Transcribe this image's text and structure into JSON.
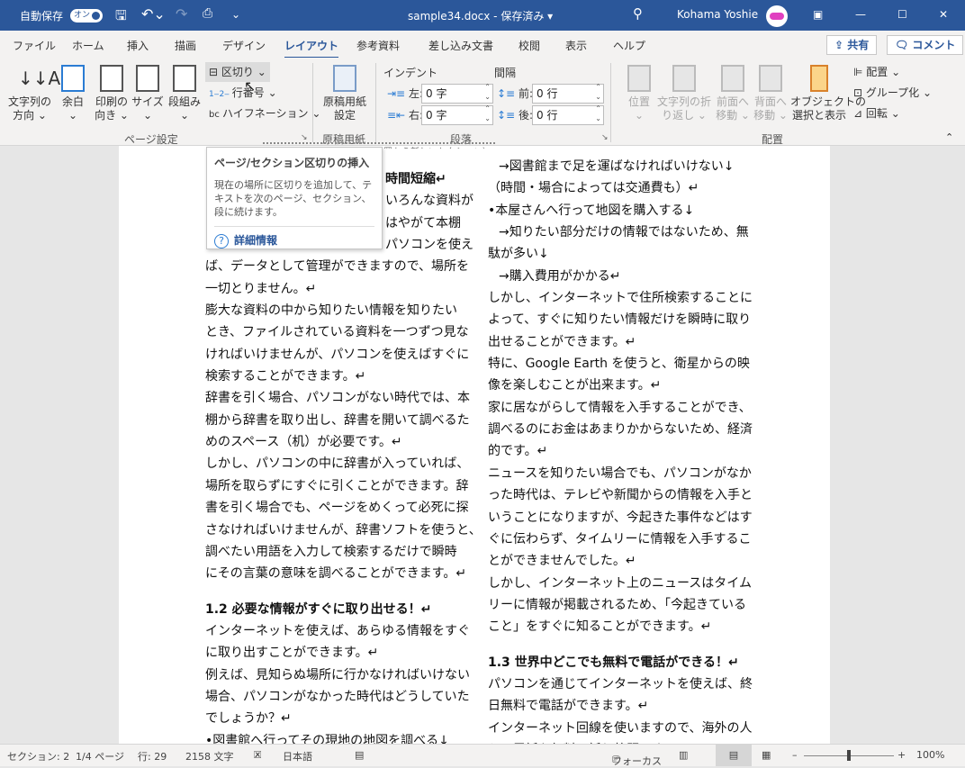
{
  "titlebar": {
    "autosave": "自動保存",
    "autosave_state": "オン",
    "title": "sample34.docx - 保存済み ▾",
    "user": "Kohama Yoshie",
    "accent": "#2b579a"
  },
  "tabs": [
    "ファイル",
    "ホーム",
    "挿入",
    "描画",
    "デザイン",
    "レイアウト",
    "参考資料",
    "差し込み文書",
    "校閲",
    "表示",
    "ヘルプ"
  ],
  "active_tab": "レイアウト",
  "share": "共有",
  "comment": "コメント",
  "ribbon": {
    "page_setup": {
      "label": "ページ設定",
      "text_direction": "文字列の\n方向 ⌄",
      "margins": "余白\n⌄",
      "orientation": "印刷の\n向き ⌄",
      "size": "サイズ\n⌄",
      "columns": "段組み\n⌄",
      "breaks": "区切り ⌄",
      "line_numbers": "行番号 ⌄",
      "hyphenation": "ハイフネーション ⌄"
    },
    "genko": {
      "label": "原稿用紙",
      "button": "原稿用紙\n設定"
    },
    "paragraph": {
      "label": "段落",
      "indent": "インデント",
      "spacing": "間隔",
      "left": "左:",
      "right": "右:",
      "before": "前:",
      "after": "後:",
      "left_val": "0 字",
      "right_val": "0 字",
      "before_val": "0 行",
      "after_val": "0 行"
    },
    "arrange": {
      "label": "配置",
      "position": "位置\n⌄",
      "wrap": "文字列の折\nり返し ⌄",
      "forward": "前面へ\n移動 ⌄",
      "backward": "背面へ\n移動 ⌄",
      "selection": "オブジェクトの\n選択と表示",
      "align": "配置 ⌄",
      "group": "グループ化 ⌄",
      "rotate": "回転 ⌄"
    }
  },
  "tooltip": {
    "title": "ページ/セクション区切りの挿入",
    "desc": "現在の場所に区切りを追加して、テキストを次のページ、セクション、段に続けます。",
    "more": "詳細情報"
  },
  "section_break": "セクション区切り（現在の位置から新しいセクション）",
  "document": {
    "left": [
      {
        "t": "時間短縮↵",
        "c": "h frag"
      },
      {
        "t": "いろんな資料が",
        "c": "frag"
      },
      {
        "t": "はやがて本棚",
        "c": "frag"
      },
      {
        "t": "パソコンを使え",
        "c": "frag"
      },
      {
        "t": "ば、データとして管理ができますので、場所を"
      },
      {
        "t": "一切とりません。↵"
      },
      {
        "t": "膨大な資料の中から知りたい情報を知りたい"
      },
      {
        "t": "とき、ファイルされている資料を一つずつ見な"
      },
      {
        "t": "ければいけませんが、パソコンを使えばすぐに"
      },
      {
        "t": "検索することができます。↵"
      },
      {
        "t": "辞書を引く場合、パソコンがない時代では、本"
      },
      {
        "t": "棚から辞書を取り出し、辞書を開いて調べるた"
      },
      {
        "t": "めのスペース（机）が必要です。↵"
      },
      {
        "t": "しかし、パソコンの中に辞書が入っていれば、"
      },
      {
        "t": "場所を取らずにすぐに引くことができます。辞"
      },
      {
        "t": "書を引く場合でも、ページをめくって必死に探"
      },
      {
        "t": "さなければいけませんが、辞書ソフトを使うと、"
      },
      {
        "t": "調べたい用語を入力して検索するだけで瞬時"
      },
      {
        "t": "にその言葉の意味を調べることができます。↵"
      },
      {
        "t": "1.2 必要な情報がすぐに取り出せる！↵",
        "c": "h"
      },
      {
        "t": "インターネットを使えば、あらゆる情報をすぐ"
      },
      {
        "t": "に取り出すことができます。↵"
      },
      {
        "t": "例えば、見知らぬ場所に行かなければいけない"
      },
      {
        "t": "場合、パソコンがなかった時代はどうしていた"
      },
      {
        "t": "でしょうか？↵"
      },
      {
        "t": "•図書館へ行ってその現地の地図を調べる↓"
      }
    ],
    "right": [
      {
        "t": "→図書館まで足を運ばなければいけない↓",
        "c": "ind"
      },
      {
        "t": "（時間・場合によっては交通費も）↵"
      },
      {
        "t": "•本屋さんへ行って地図を購入する↓"
      },
      {
        "t": "→知りたい部分だけの情報ではないため、無",
        "c": "ind"
      },
      {
        "t": "駄が多い↓"
      },
      {
        "t": "→購入費用がかかる↵",
        "c": "ind"
      },
      {
        "t": "しかし、インターネットで住所検索することに"
      },
      {
        "t": "よって、すぐに知りたい情報だけを瞬時に取り"
      },
      {
        "t": "出せることができます。↵"
      },
      {
        "t": "特に、Google Earth を使うと、衛星からの映"
      },
      {
        "t": "像を楽しむことが出来ます。↵"
      },
      {
        "t": "家に居ながらして情報を入手することができ、"
      },
      {
        "t": "調べるのにお金はあまりかからないため、経済"
      },
      {
        "t": "的です。↵"
      },
      {
        "t": "ニュースを知りたい場合でも、パソコンがなか"
      },
      {
        "t": "った時代は、テレビや新聞からの情報を入手と"
      },
      {
        "t": "いうことになりますが、今起きた事件などはす"
      },
      {
        "t": "ぐに伝わらず、タイムリーに情報を入手するこ"
      },
      {
        "t": "とができませんでした。↵"
      },
      {
        "t": "しかし、インターネット上のニュースはタイム"
      },
      {
        "t": "リーに情報が掲載されるため、「今起きている"
      },
      {
        "t": "こと」をすぐに知ることができます。↵"
      },
      {
        "t": "1.3 世界中どこでも無料で電話ができる！↵",
        "c": "h"
      },
      {
        "t": "パソコンを通じてインターネットを使えば、終"
      },
      {
        "t": "日無料で電話ができます。↵"
      },
      {
        "t": "インターネット回線を使いますので、海外の人"
      },
      {
        "t": "との電話も無料で話し放題です。↵"
      }
    ]
  },
  "status": {
    "section": "セクション: 2",
    "page": "1/4 ページ",
    "line": "行: 29",
    "words": "2158 文字",
    "language": "日本語",
    "focus": "フォーカス",
    "zoom": "100%",
    "zoom_percent": 100
  }
}
